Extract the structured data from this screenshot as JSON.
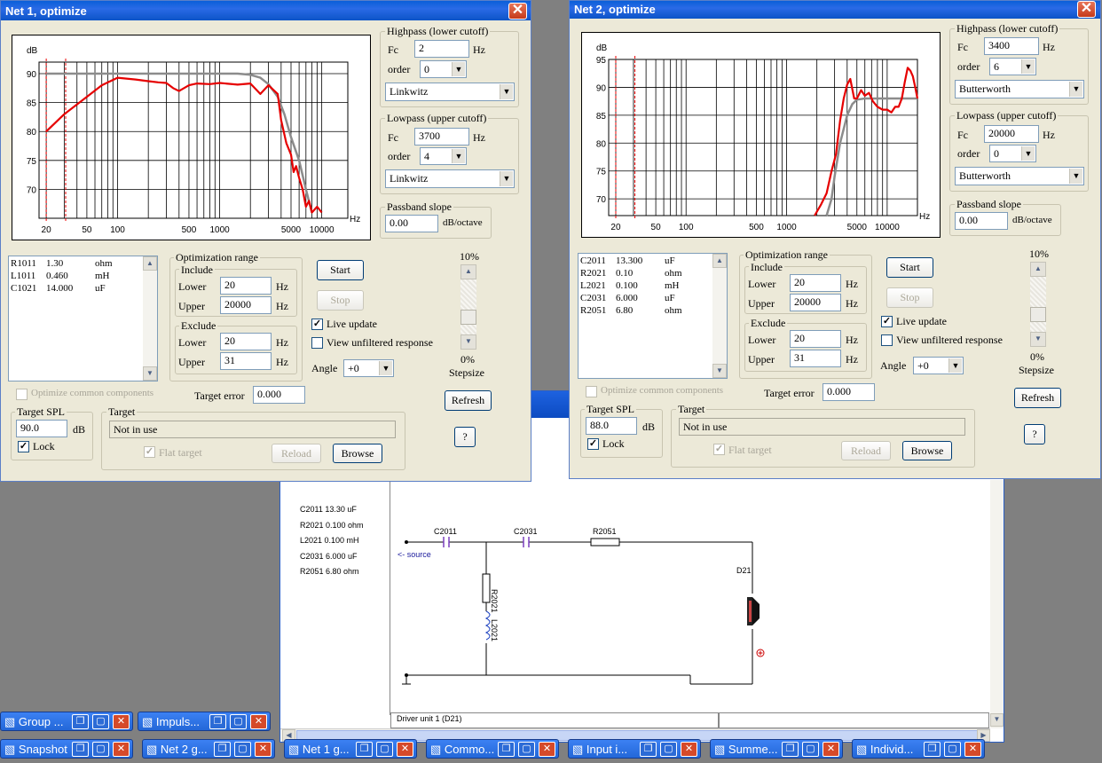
{
  "net1": {
    "title": "Net 1, optimize",
    "chart_data": {
      "type": "line",
      "ylabel": "dB",
      "xlabel": "Hz",
      "xscale": "log",
      "xlim": [
        17,
        18000
      ],
      "ylim": [
        65,
        92
      ],
      "x_ticks": [
        "20",
        "50",
        "100",
        "500",
        "1000",
        "5000",
        "10000"
      ],
      "y_ticks": [
        "90",
        "85",
        "80",
        "75",
        "70"
      ],
      "exclude_lines": [
        20,
        31
      ],
      "series": [
        {
          "color": "#8c8c8c",
          "x": [
            20,
            1500,
            2000,
            2500,
            3000,
            3700,
            4300,
            5000,
            6000,
            7000,
            8000
          ],
          "y": [
            90,
            90,
            89.8,
            89.3,
            88.2,
            86,
            83,
            79,
            75,
            70,
            66
          ]
        },
        {
          "color": "#e60000",
          "x": [
            20,
            30,
            50,
            70,
            100,
            150,
            200,
            250,
            300,
            350,
            400,
            500,
            600,
            800,
            1000,
            1500,
            2000,
            2500,
            3000,
            3700,
            4000,
            4500,
            5000,
            5300,
            5600,
            6000,
            6500,
            7000,
            7500,
            8000,
            9000,
            10000
          ],
          "y": [
            80,
            83,
            86,
            88,
            89.3,
            89,
            88.7,
            88.5,
            88.4,
            87.5,
            87,
            88,
            88.3,
            88.2,
            88.4,
            88.1,
            88.3,
            86.5,
            88,
            86.5,
            82,
            78,
            76,
            73,
            74,
            72,
            70,
            67,
            68,
            66,
            67,
            66
          ]
        }
      ]
    },
    "highpass": {
      "label": "Highpass (lower cutoff)",
      "fc_label": "Fc",
      "fc": "2",
      "unit": "Hz",
      "order_label": "order",
      "order": "0",
      "type": "Linkwitz"
    },
    "lowpass": {
      "label": "Lowpass (upper cutoff)",
      "fc_label": "Fc",
      "fc": "3700",
      "unit": "Hz",
      "order_label": "order",
      "order": "4",
      "type": "Linkwitz"
    },
    "slope": {
      "label": "Passband slope",
      "value": "0.00",
      "unit": "dB/octave"
    },
    "components": [
      {
        "name": "R1011",
        "value": "1.30",
        "unit": "ohm"
      },
      {
        "name": "L1011",
        "value": "0.460",
        "unit": "mH"
      },
      {
        "name": "C1021",
        "value": "14.000",
        "unit": "uF"
      }
    ],
    "optrange": {
      "label": "Optimization range",
      "include": "Include",
      "exclude": "Exclude",
      "lower_label": "Lower",
      "upper_label": "Upper",
      "inc_lower": "20",
      "inc_upper": "20000",
      "exc_lower": "20",
      "exc_upper": "31",
      "unit": "Hz"
    },
    "buttons": {
      "start": "Start",
      "stop": "Stop",
      "refresh": "Refresh",
      "help": "?",
      "reload": "Reload",
      "browse": "Browse"
    },
    "live_update": "Live update",
    "view_unfiltered": "View unfiltered response",
    "angle_label": "Angle",
    "angle": "+0",
    "step_top": "10%",
    "step_bottom": "0%",
    "stepsize": "Stepsize",
    "stepsize_level": 0.25,
    "optimize_common": "Optimize common components",
    "target_error_label": "Target error",
    "target_error": "0.000",
    "target_spl": {
      "label": "Target SPL",
      "value": "90.0",
      "unit": "dB",
      "lock": "Lock"
    },
    "target": {
      "label": "Target",
      "value": "Not in use",
      "flat": "Flat target"
    }
  },
  "net2": {
    "title": "Net 2, optimize",
    "chart_data": {
      "type": "line",
      "ylabel": "dB",
      "xlabel": "Hz",
      "xscale": "log",
      "xlim": [
        17,
        20000
      ],
      "ylim": [
        67,
        95
      ],
      "x_ticks": [
        "20",
        "50",
        "100",
        "500",
        "1000",
        "5000",
        "10000"
      ],
      "y_ticks": [
        "95",
        "90",
        "85",
        "80",
        "75",
        "70"
      ],
      "exclude_lines": [
        20,
        31
      ],
      "series": [
        {
          "color": "#8c8c8c",
          "x": [
            2500,
            2800,
            3000,
            3400,
            4000,
            4500,
            5000,
            6000,
            8000,
            20000
          ],
          "y": [
            67,
            70,
            74,
            80,
            85,
            87,
            87.8,
            88,
            88,
            88
          ]
        },
        {
          "color": "#e60000",
          "x": [
            1900,
            2200,
            2500,
            2800,
            3100,
            3400,
            3700,
            4000,
            4300,
            4700,
            5000,
            5500,
            6000,
            6600,
            7200,
            8000,
            9000,
            10000,
            11000,
            12000,
            13000,
            14000,
            15000,
            16000,
            17000,
            18000,
            19000,
            20000
          ],
          "y": [
            67,
            69,
            71,
            75,
            78,
            84,
            88,
            90.5,
            91.5,
            88,
            88,
            89.5,
            88.5,
            89,
            87.5,
            86.5,
            86,
            86,
            85.5,
            86.5,
            86.5,
            88,
            91,
            93.5,
            93,
            92,
            90,
            88
          ]
        }
      ]
    },
    "highpass": {
      "label": "Highpass (lower cutoff)",
      "fc_label": "Fc",
      "fc": "3400",
      "unit": "Hz",
      "order_label": "order",
      "order": "6",
      "type": "Butterworth"
    },
    "lowpass": {
      "label": "Lowpass (upper cutoff)",
      "fc_label": "Fc",
      "fc": "20000",
      "unit": "Hz",
      "order_label": "order",
      "order": "0",
      "type": "Butterworth"
    },
    "slope": {
      "label": "Passband slope",
      "value": "0.00",
      "unit": "dB/octave"
    },
    "components": [
      {
        "name": "C2011",
        "value": "13.300",
        "unit": "uF"
      },
      {
        "name": "R2021",
        "value": "0.10",
        "unit": "ohm"
      },
      {
        "name": "L2021",
        "value": "0.100",
        "unit": "mH"
      },
      {
        "name": "C2031",
        "value": "6.000",
        "unit": "uF"
      },
      {
        "name": "R2051",
        "value": "6.80",
        "unit": "ohm"
      }
    ],
    "optrange": {
      "label": "Optimization range",
      "include": "Include",
      "exclude": "Exclude",
      "lower_label": "Lower",
      "upper_label": "Upper",
      "inc_lower": "20",
      "inc_upper": "20000",
      "exc_lower": "20",
      "exc_upper": "31",
      "unit": "Hz"
    },
    "buttons": {
      "start": "Start",
      "stop": "Stop",
      "refresh": "Refresh",
      "help": "?",
      "reload": "Reload",
      "browse": "Browse"
    },
    "live_update": "Live update",
    "view_unfiltered": "View unfiltered response",
    "angle_label": "Angle",
    "angle": "+0",
    "step_top": "10%",
    "step_bottom": "0%",
    "stepsize": "Stepsize",
    "stepsize_level": 0.25,
    "optimize_common": "Optimize common components",
    "target_error_label": "Target error",
    "target_error": "0.000",
    "target_spl": {
      "label": "Target SPL",
      "value": "88.0",
      "unit": "dB",
      "lock": "Lock"
    },
    "target": {
      "label": "Target",
      "value": "Not in use",
      "flat": "Flat target"
    }
  },
  "schematic": {
    "values": [
      "C2011  13.30 uF",
      "R2021  0.100 ohm",
      "L2021  0.100 mH",
      "C2031  6.000 uF",
      "R2051    6.80 ohm"
    ],
    "labels": {
      "c2011": "C2011",
      "c2031": "C2031",
      "r2051": "R2051",
      "r2021": "R2021",
      "l2021": "L2021",
      "d21": "D21",
      "source": "<- source"
    },
    "status": "Driver unit 1 (D21)"
  },
  "taskbar": {
    "row1": [
      "Group ...",
      "Impuls..."
    ],
    "row2": [
      "Snapshot",
      "Net 2 g...",
      "Net 1 g...",
      "Commo...",
      "Input i...",
      "Summe...",
      "Individ..."
    ]
  },
  "icons": {
    "minimize": "❐",
    "maximize": "▢",
    "close": "✕"
  }
}
